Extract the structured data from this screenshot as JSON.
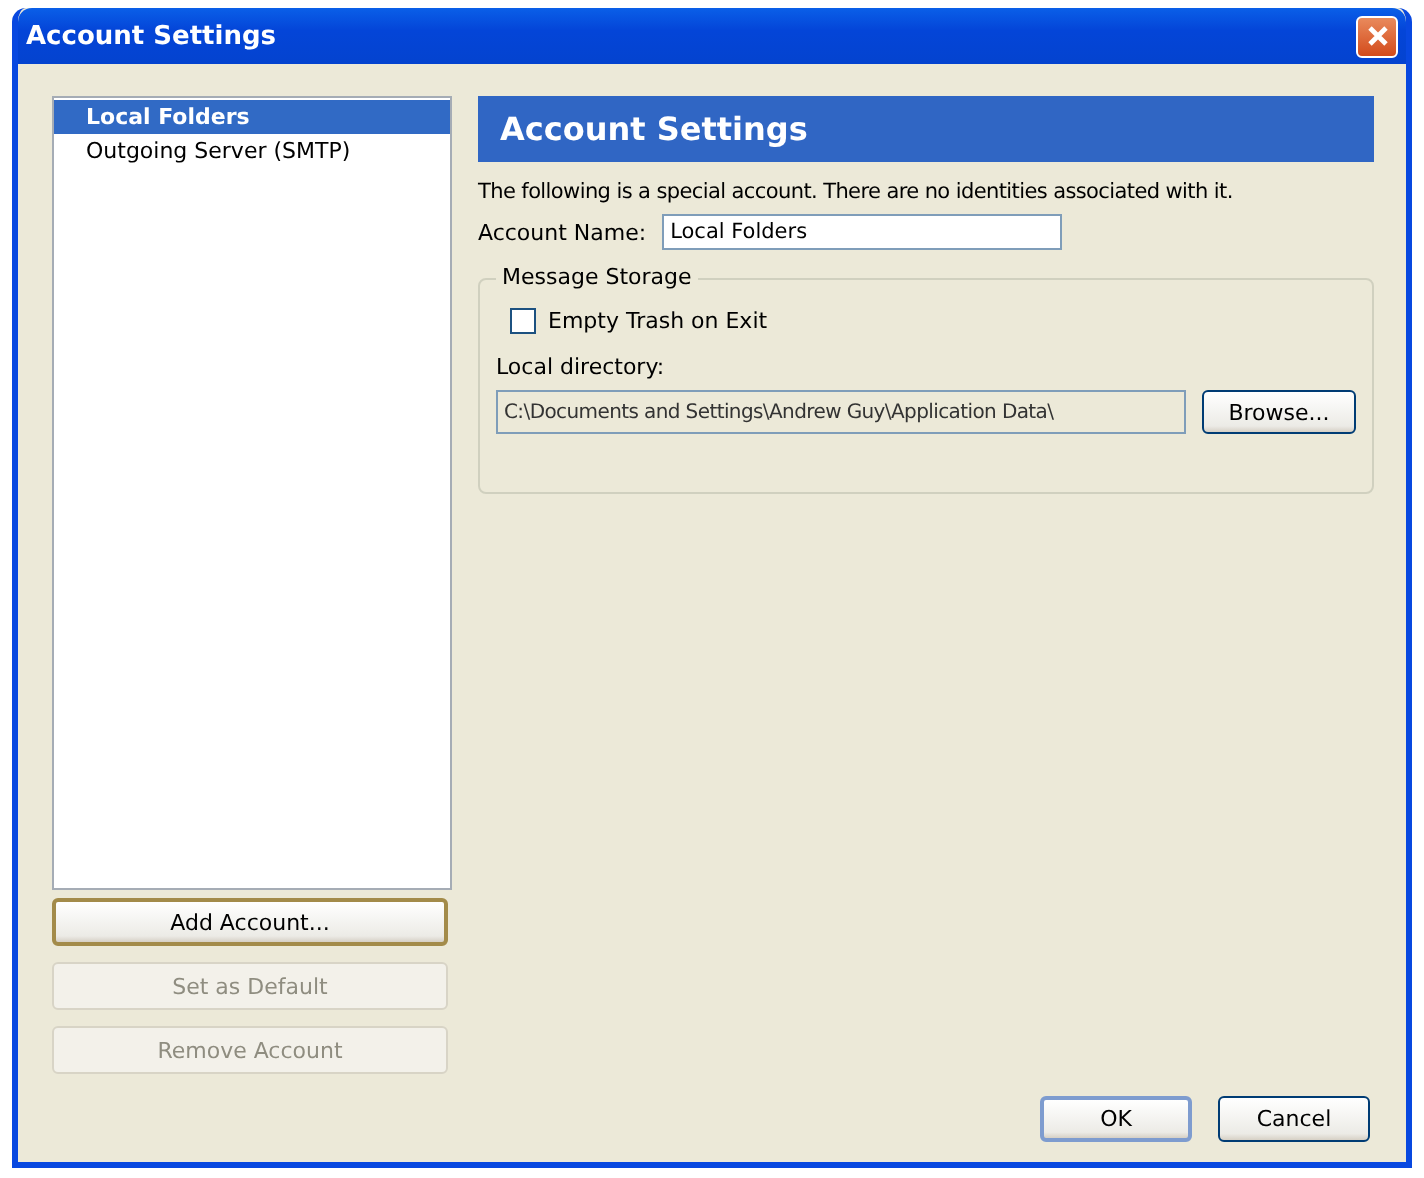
{
  "window": {
    "title": "Account Settings"
  },
  "accounts": [
    {
      "label": "Local Folders",
      "selected": true
    },
    {
      "label": "Outgoing Server (SMTP)",
      "selected": false
    }
  ],
  "account_buttons": [
    {
      "label": "Add Account...",
      "disabled": false
    },
    {
      "label": "Set as Default",
      "disabled": true
    },
    {
      "label": "Remove Account",
      "disabled": true
    }
  ],
  "panel": {
    "heading": "Account Settings",
    "description": "The following is a special account. There are no identities associated with it.",
    "name_label": "Account Name:",
    "name_value": "Local Folders",
    "storage": {
      "legend": "Message Storage",
      "empty_trash": {
        "label": "Empty Trash on Exit",
        "checked": false
      },
      "directory_label": "Local directory:",
      "directory_value": "C:\\Documents and Settings\\Andrew Guy\\Application Data\\",
      "browse": "Browse..."
    }
  },
  "buttons": [
    {
      "label": "OK",
      "default": true
    },
    {
      "label": "Cancel",
      "default": false
    }
  ]
}
